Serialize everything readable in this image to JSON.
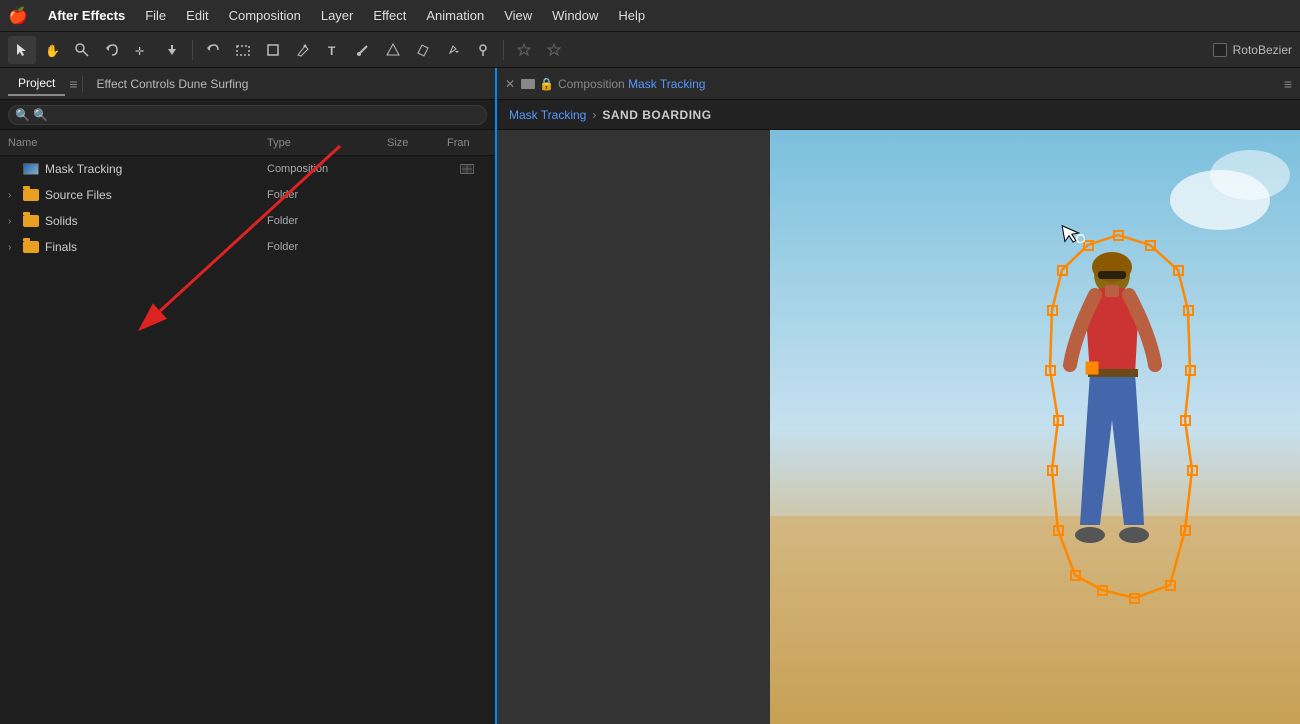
{
  "menubar": {
    "apple": "🍎",
    "app_name": "After Effects",
    "menus": [
      "File",
      "Edit",
      "Composition",
      "Layer",
      "Effect",
      "Animation",
      "View",
      "Window",
      "Help"
    ]
  },
  "toolbar": {
    "tools": [
      {
        "name": "select-tool",
        "icon": "↖",
        "active": true
      },
      {
        "name": "hand-tool",
        "icon": "✋"
      },
      {
        "name": "zoom-tool",
        "icon": "🔍"
      },
      {
        "name": "rotate-tool",
        "icon": "↺"
      },
      {
        "name": "move-tool",
        "icon": "✛"
      },
      {
        "name": "puppet-tool",
        "icon": "⬇"
      },
      {
        "name": "undo-tool",
        "icon": "↩"
      },
      {
        "name": "rect-tool",
        "icon": "▭"
      },
      {
        "name": "shape-tool",
        "icon": "◻"
      },
      {
        "name": "pen-tool",
        "icon": "✒"
      },
      {
        "name": "text-tool",
        "icon": "T"
      },
      {
        "name": "brush-tool",
        "icon": "/"
      },
      {
        "name": "clone-tool",
        "icon": "⬆"
      },
      {
        "name": "eraser-tool",
        "icon": "◇"
      },
      {
        "name": "paint-tool",
        "icon": "✦"
      },
      {
        "name": "pin-tool",
        "icon": "📌"
      }
    ],
    "rotobezier_label": "RotoBezier"
  },
  "left_panel": {
    "project_tab": "Project",
    "effect_controls_tab": "Effect Controls Dune Surfing",
    "search_placeholder": "🔍",
    "columns": {
      "name": "Name",
      "type": "Type",
      "size": "Size",
      "fran": "Fran"
    },
    "items": [
      {
        "name": "Mask Tracking",
        "type": "Composition",
        "size": "",
        "has_icon": true,
        "icon_type": "comp"
      },
      {
        "name": "Source Files",
        "type": "Folder",
        "size": "",
        "icon_type": "folder"
      },
      {
        "name": "Solids",
        "type": "Folder",
        "size": "",
        "icon_type": "folder"
      },
      {
        "name": "Finals",
        "type": "Folder",
        "size": "",
        "icon_type": "folder"
      }
    ]
  },
  "right_panel": {
    "comp_label": "Composition",
    "comp_name": "Mask Tracking",
    "breadcrumb_link": "Mask Tracking",
    "breadcrumb_separator": "›",
    "breadcrumb_current": "SAND BOARDING"
  }
}
